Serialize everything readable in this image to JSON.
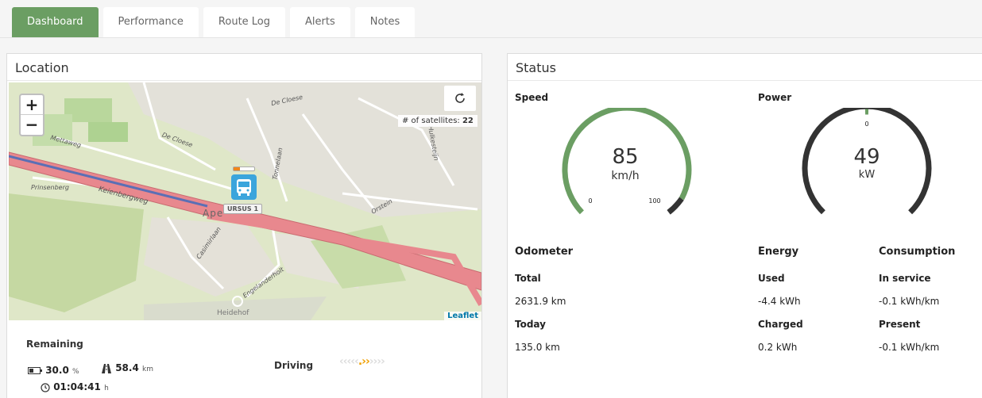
{
  "tabs": [
    "Dashboard",
    "Performance",
    "Route Log",
    "Alerts",
    "Notes"
  ],
  "location": {
    "title": "Location",
    "zoom_in": "+",
    "zoom_out": "−",
    "satellites_label": "# of satellites:",
    "satellites": "22",
    "attribution": "Leaflet",
    "vehicle_label": "URSUS 1",
    "town": "Ape",
    "place": "Heidehof",
    "streets": [
      "De Cloese",
      "Mettaweg",
      "Keienbergweg",
      "Prinsenberg",
      "Casimirlaan",
      "Engelanderholt",
      "Orstein",
      "Hulkesteijn",
      "Tonnelaan",
      "De Cloese"
    ]
  },
  "remaining": {
    "title": "Remaining",
    "battery": "30.0",
    "battery_unit": "%",
    "range": "58.4",
    "range_unit": "km",
    "time": "01:04:41",
    "time_unit": "h",
    "state": "Driving"
  },
  "status": {
    "title": "Status",
    "speed_label": "Speed",
    "speed": "85",
    "speed_unit": "km/h",
    "speed_min": "0",
    "speed_max": "100",
    "power_label": "Power",
    "power": "49",
    "power_unit": "kW",
    "power_zero": "0",
    "odometer": "Odometer",
    "energy": "Energy",
    "consumption": "Consumption",
    "total_label": "Total",
    "total": "2631.9 km",
    "today_label": "Today",
    "today": "135.0 km",
    "used_label": "Used",
    "used": "-4.4 kWh",
    "charged_label": "Charged",
    "charged": "0.2 kWh",
    "in_service_label": "In service",
    "in_service": "-0.1 kWh/km",
    "present_label": "Present",
    "present": "-0.1 kWh/km"
  },
  "colors": {
    "accent": "#6b9e63",
    "road": "#e8888e",
    "bus": "#3ba5dc"
  }
}
